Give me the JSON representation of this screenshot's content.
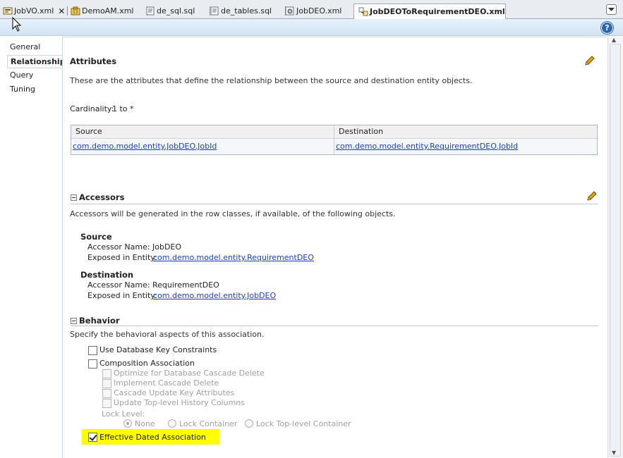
{
  "tabs": [
    {
      "label": "JobVO.xml",
      "icon": "xml-view-icon",
      "close": "✕"
    },
    {
      "label": "DemoAM.xml",
      "icon": "app-module-icon"
    },
    {
      "label": "de_sql.sql",
      "icon": "sql-file-icon"
    },
    {
      "label": "de_tables.sql",
      "icon": "sql-file-icon"
    },
    {
      "label": "JobDEO.xml",
      "icon": "entity-gear-icon"
    },
    {
      "label": "JobDEOToRequirementDEO.xml",
      "icon": "association-icon",
      "active": true
    }
  ],
  "help_label": "?",
  "nav": {
    "items": [
      {
        "label": "General"
      },
      {
        "label": "Relationship",
        "active": true
      },
      {
        "label": "Query"
      },
      {
        "label": "Tuning"
      }
    ]
  },
  "attributes": {
    "title": "Attributes",
    "description": "These are the attributes that define the relationship between the source and destination entity objects.",
    "cardinality_label": "Cardinality:",
    "cardinality_value": "1 to *",
    "table": {
      "columns": [
        "Source",
        "Destination"
      ],
      "rows": [
        [
          "com.demo.model.entity.JobDEO.JobId",
          "com.demo.model.entity.RequirementDEO.JobId"
        ]
      ]
    }
  },
  "accessors": {
    "title": "Accessors",
    "description": "Accessors will be generated in the row classes, if available, of the following objects.",
    "source": {
      "heading": "Source",
      "accessor_label": "Accessor Name:",
      "accessor_value": "JobDEO",
      "exposed_label": "Exposed in Entity:",
      "exposed_value": "com.demo.model.entity.RequirementDEO"
    },
    "destination": {
      "heading": "Destination",
      "accessor_label": "Accessor Name:",
      "accessor_value": "RequirementDEO",
      "exposed_label": "Exposed in Entity:",
      "exposed_value": "com.demo.model.entity.JobDEO"
    }
  },
  "behavior": {
    "title": "Behavior",
    "description": "Specify the behavioral aspects of this association.",
    "use_db_key": {
      "label": "Use Database Key Constraints",
      "checked": false
    },
    "composition": {
      "label": "Composition Association",
      "checked": false
    },
    "optimize_cascade": {
      "label": "Optimize for Database Cascade Delete",
      "checked": false,
      "enabled": false
    },
    "implement_cascade": {
      "label": "Implement Cascade Delete",
      "checked": false,
      "enabled": false
    },
    "cascade_update": {
      "label": "Cascade Update Key Attributes",
      "checked": false,
      "enabled": false
    },
    "update_history": {
      "label": "Update Top-level History Columns",
      "checked": false,
      "enabled": false
    },
    "lock_level": {
      "label": "Lock Level:",
      "options": [
        "None",
        "Lock Container",
        "Lock Top-level Container"
      ],
      "selected": "None",
      "enabled": false
    },
    "effective_dated": {
      "label": "Effective Dated Association",
      "checked": true,
      "highlight_color": "#ffff00"
    }
  },
  "colors": {
    "link": "#1a3ec6",
    "accent": "#2a67b4",
    "highlight": "#ffff00"
  }
}
